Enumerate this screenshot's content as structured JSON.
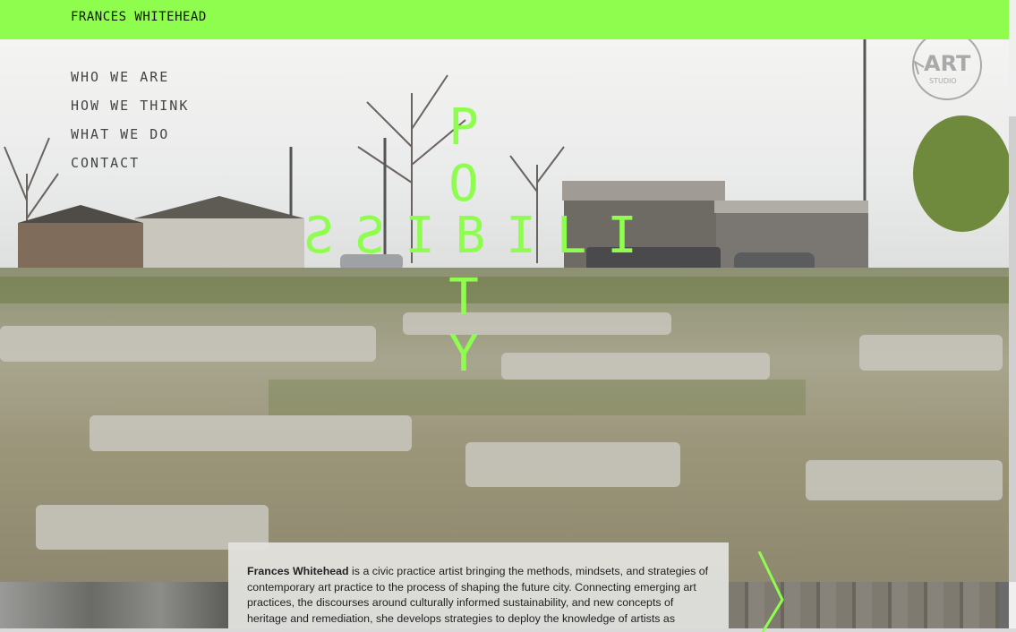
{
  "header": {
    "brand": "FRANCES WHITEHEAD"
  },
  "nav": {
    "items": [
      {
        "label": "WHO WE ARE"
      },
      {
        "label": "HOW WE THINK"
      },
      {
        "label": "WHAT WE DO"
      },
      {
        "label": "CONTACT"
      }
    ]
  },
  "crossword": {
    "horizontal": "SSIBILI",
    "vertical": "POTY"
  },
  "logo": {
    "text": "ART",
    "subtext": "STUDIO"
  },
  "intro": {
    "name": "Frances Whitehead",
    "text": " is a civic practice artist bringing the methods, mindsets, and strategies of contemporary art practice to the process of shaping the future city. Connecting emerging art practices, the discourses around culturally informed sustainability, and new concepts of heritage and remediation, she develops strategies to deploy the knowledge of artists as"
  },
  "colors": {
    "accent": "#8efd4e"
  },
  "icons": {
    "next": "chevron-right-icon",
    "logo": "art-studio-logo-icon"
  }
}
